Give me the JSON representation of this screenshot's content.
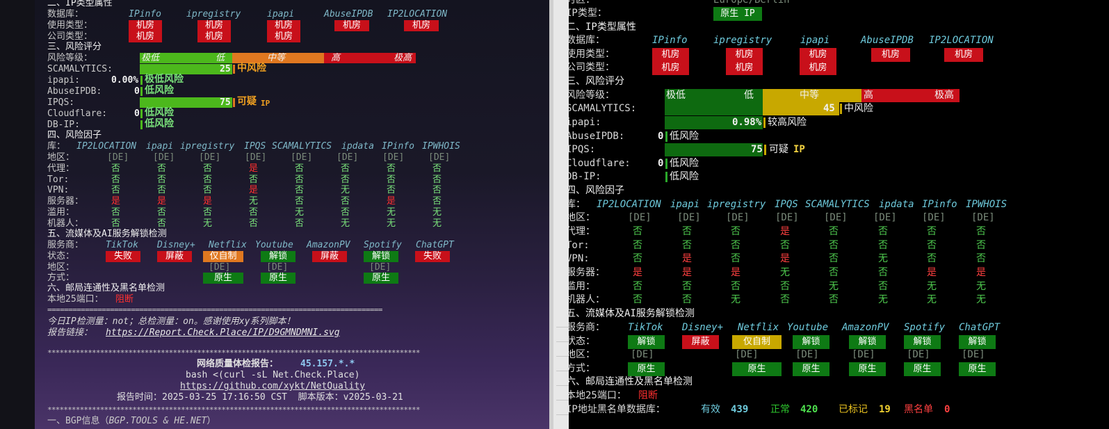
{
  "left": {
    "sec2": "二、IP类型属性",
    "db_label": "数据库：",
    "dbs": [
      "IPinfo",
      "ipregistry",
      "ipapi",
      "AbuseIPDB",
      "IP2LOCATION"
    ],
    "usage_label": "使用类型：",
    "company_label": "公司类型：",
    "jifang": "机房",
    "sec3": "三、风险评分",
    "risk_label": "风险等级：",
    "scale": [
      "极低",
      "低",
      "中等",
      "高",
      "极高"
    ],
    "scam_label": "SCAMALYTICS:",
    "scam_val": "25",
    "scam_text": "中风险",
    "ipapi_label": "ipapi:",
    "ipapi_val": "0.00%",
    "ipapi_text": "极低风险",
    "abuse_label": "AbuseIPDB:",
    "abuse_val": "0",
    "abuse_text": "低风险",
    "ipqs_label": "IPQS:",
    "ipqs_val": "75",
    "ipqs_text": "可疑",
    "ipqs_suffix": "IP",
    "cf_label": "Cloudflare:",
    "cf_val": "0",
    "cf_text": "低风险",
    "dbip_label": "DB-IP:",
    "dbip_text": "低风险",
    "sec4": "四、风险因子",
    "lib_label": "库：",
    "factor_dbs": [
      "IP2LOCATION",
      "ipapi",
      "ipregistry",
      "IPQS",
      "SCAMALYTICS",
      "ipdata",
      "IPinfo",
      "IPWHOIS"
    ],
    "region_label": "地区：",
    "region_vals": [
      "[DE]",
      "[DE]",
      "[DE]",
      "[DE]",
      "[DE]",
      "[DE]",
      "[DE]",
      "[DE]"
    ],
    "proxy_label": "代理：",
    "proxy_vals": [
      "否",
      "否",
      "否",
      "是",
      "否",
      "否",
      "否",
      "否"
    ],
    "tor_label": "Tor:",
    "tor_vals": [
      "否",
      "否",
      "否",
      "否",
      "否",
      "否",
      "否",
      "否"
    ],
    "vpn_label": "VPN:",
    "vpn_vals": [
      "否",
      "否",
      "否",
      "是",
      "否",
      "无",
      "否",
      "否"
    ],
    "server_label": "服务器：",
    "server_vals": [
      "是",
      "是",
      "是",
      "无",
      "否",
      "否",
      "是",
      "否"
    ],
    "abuse2_label": "滥用：",
    "abuse2_vals": [
      "否",
      "否",
      "否",
      "否",
      "无",
      "否",
      "无",
      "无"
    ],
    "robot_label": "机器人：",
    "robot_vals": [
      "否",
      "否",
      "无",
      "否",
      "否",
      "无",
      "无",
      "无"
    ],
    "sec5": "五、流媒体及AI服务解锁检测",
    "provider_label": "服务商：",
    "providers": [
      "TikTok",
      "Disney+",
      "Netflix",
      "Youtube",
      "AmazonPV",
      "Spotify",
      "ChatGPT"
    ],
    "status_label": "状态：",
    "statuses": [
      "失败",
      "屏蔽",
      "仅自制",
      "解锁",
      "屏蔽",
      "解锁",
      "失败"
    ],
    "area_label": "地区：",
    "areas": [
      "",
      "",
      "[DE]",
      "[DE]",
      "",
      "[DE]",
      ""
    ],
    "method_label": "方式：",
    "methods": [
      "",
      "",
      "原生",
      "原生",
      "",
      "原生",
      ""
    ],
    "sec6": "六、邮局连通性及黑名单检测",
    "port_label": "本地25端口：",
    "port_val": "阻断",
    "separator": "================================================================================",
    "today_line": "今日IP检测量：not；总检测量：on。感谢使用xy系列脚本！",
    "report_label": "报告链接：",
    "report_link": "https://Report.Check.Place/IP/D9GMNDMNI.svg",
    "stars": "********************************************************************************************",
    "nq_title": "网络质量体检报告：",
    "nq_ip": "45.157.*.*",
    "nq_cmd": "bash <(curl -sL Net.Check.Place)",
    "nq_url": "https://github.com/xykt/NetQuality",
    "nq_time": "报告时间：2025-03-25 17:16:50 CST  脚本版本：v2025-03-21",
    "bgp": "一、BGP信息（",
    "bgp_src": "BGP.TOOLS & HE.NET",
    "bgp_end": "）"
  },
  "right": {
    "top_cut": "时区：",
    "top_cut_val": "Europe/Berlin",
    "iptype_label": "IP类型：",
    "iptype_val": "原生 IP",
    "sec2": "二、IP类型属性",
    "db_label": "数据库：",
    "dbs": [
      "IPinfo",
      "ipregistry",
      "ipapi",
      "AbuseIPDB",
      "IP2LOCATION"
    ],
    "usage_label": "使用类型：",
    "company_label": "公司类型：",
    "jifang": "机房",
    "sec3": "三、风险评分",
    "risk_label": "风险等级：",
    "scale": [
      "极低",
      "低",
      "中等",
      "高",
      "极高"
    ],
    "scam_label": "SCAMALYTICS:",
    "scam_val": "45",
    "scam_text": "中风险",
    "ipapi_label": "ipapi:",
    "ipapi_val": "0.98%",
    "ipapi_text": "较高风险",
    "abuse_label": "AbuseIPDB:",
    "abuse_val": "0",
    "abuse_text": "低风险",
    "ipqs_label": "IPQS:",
    "ipqs_val": "75",
    "ipqs_text": "可疑",
    "ipqs_suffix": "IP",
    "cf_label": "Cloudflare:",
    "cf_val": "0",
    "cf_text": "低风险",
    "dbip_label": "DB-IP:",
    "dbip_text": "低风险",
    "sec4": "四、风险因子",
    "lib_label": "库：",
    "factor_dbs": [
      "IP2LOCATION",
      "ipapi",
      "ipregistry",
      "IPQS",
      "SCAMALYTICS",
      "ipdata",
      "IPinfo",
      "IPWHOIS"
    ],
    "region_label": "地区：",
    "region_vals": [
      "[DE]",
      "[DE]",
      "[DE]",
      "[DE]",
      "[DE]",
      "[DE]",
      "[DE]",
      "[DE]"
    ],
    "proxy_label": "代理：",
    "proxy_vals": [
      "否",
      "否",
      "否",
      "是",
      "否",
      "否",
      "否",
      "否"
    ],
    "tor_label": "Tor:",
    "tor_vals": [
      "否",
      "否",
      "否",
      "否",
      "否",
      "否",
      "否",
      "否"
    ],
    "vpn_label": "VPN:",
    "vpn_vals": [
      "否",
      "是",
      "否",
      "是",
      "否",
      "无",
      "否",
      "否"
    ],
    "server_label": "服务器：",
    "server_vals": [
      "是",
      "是",
      "是",
      "无",
      "否",
      "否",
      "是",
      "是"
    ],
    "abuse2_label": "滥用：",
    "abuse2_vals": [
      "否",
      "否",
      "否",
      "否",
      "无",
      "否",
      "无",
      "无"
    ],
    "robot_label": "机器人：",
    "robot_vals": [
      "否",
      "否",
      "无",
      "否",
      "否",
      "无",
      "无",
      "无"
    ],
    "sec5": "五、流媒体及AI服务解锁检测",
    "provider_label": "服务商：",
    "providers": [
      "TikTok",
      "Disney+",
      "Netflix",
      "Youtube",
      "AmazonPV",
      "Spotify",
      "ChatGPT"
    ],
    "status_label": "状态：",
    "statuses": [
      "解锁",
      "屏蔽",
      "仅自制",
      "解锁",
      "解锁",
      "解锁",
      "解锁"
    ],
    "area_label": "地区：",
    "areas": [
      "[DE]",
      "",
      "[DE]",
      "[DE]",
      "[DE]",
      "[DE]",
      "[DE]"
    ],
    "method_label": "方式：",
    "methods": [
      "原生",
      "",
      "原生",
      "原生",
      "原生",
      "原生",
      "原生"
    ],
    "sec6": "六、邮局连通性及黑名单检测",
    "port_label": "本地25端口：",
    "port_val": "阻断",
    "bl_label": "IP地址黑名单数据库：",
    "bl_valid_label": "有效",
    "bl_valid": "439",
    "bl_ok_label": "正常",
    "bl_ok": "420",
    "bl_marked_label": "已标记",
    "bl_marked": "19",
    "bl_black_label": "黑名单",
    "bl_black": "0"
  },
  "colors": {
    "badge_red": "#c8101a",
    "badge_green": "#0e7a14",
    "badge_orange": "#e07820",
    "badge_yellow": "#c8a800",
    "bar_green": "#4cb81c",
    "bar_orange": "#e07820",
    "bar_red": "#c8101a"
  }
}
